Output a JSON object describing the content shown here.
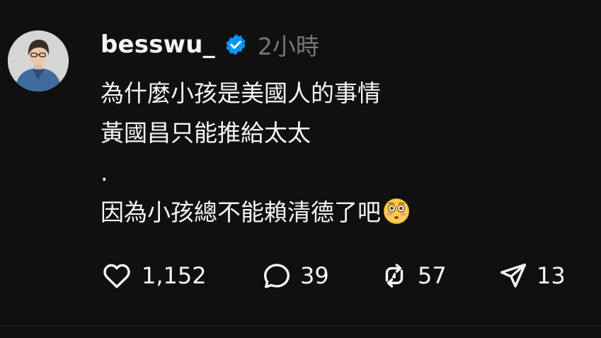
{
  "post": {
    "username": "besswu_",
    "timestamp": "2小時",
    "lines": [
      "為什麼小孩是美國人的事情",
      "黃國昌只能推給太太",
      ".",
      "因為小孩總不能賴清德了吧"
    ],
    "emoji": "flushed-face-emoji",
    "verified_color": "#0095f6"
  },
  "actions": {
    "likes": "1,152",
    "replies": "39",
    "reposts": "57",
    "shares": "13"
  },
  "icons": {
    "like": "heart-icon",
    "reply": "comment-bubble-icon",
    "repost": "repost-icon",
    "share": "send-icon"
  }
}
